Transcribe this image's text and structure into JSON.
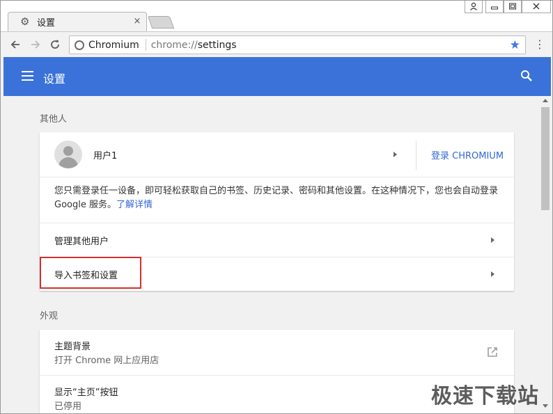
{
  "tab": {
    "title": "设置",
    "icon": "gear-icon",
    "close_label": "×"
  },
  "window_controls": {
    "user": "user-icon",
    "minimize": "minimize-icon",
    "restore": "restore-icon",
    "close": "close-icon"
  },
  "toolbar": {
    "origin": "Chromium",
    "url_scheme": "chrome://",
    "url_path": "settings"
  },
  "appbar": {
    "title": "设置"
  },
  "sections": {
    "people": {
      "title": "其他人",
      "user_name": "用户1",
      "signin_label": "登录 CHROMIUM",
      "description": "您只需登录任一设备，即可轻松获取自己的书签、历史记录、密码和其他设置。在这种情况下，您也会自动登录 Google 服务。",
      "learn_more": "了解详情",
      "manage_users": "管理其他用户",
      "import_bookmarks": "导入书签和设置"
    },
    "appearance": {
      "title": "外观",
      "theme_label": "主题背景",
      "theme_sub": "打开 Chrome 网上应用店",
      "home_button_label": "显示“主页”按钮",
      "home_button_sub": "已停用"
    }
  },
  "watermark": "极速下载站",
  "colors": {
    "accent": "#3b72d9",
    "link": "#3367d6",
    "highlight": "#d32f2f"
  }
}
